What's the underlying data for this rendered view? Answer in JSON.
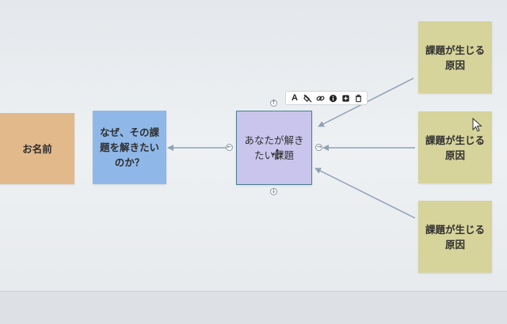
{
  "canvas": {
    "notes": {
      "name": {
        "label": "お名前",
        "color": "#e2b98b"
      },
      "why": {
        "label": "なぜ、その課\n題を解きたい\nのか？",
        "color": "#8fb8e8"
      },
      "center": {
        "label": "あなたが解き\nたい課題",
        "color": "#c9c5ec"
      },
      "causes": [
        {
          "label": "課題が生じる\n原因",
          "color": "#d6d39b"
        },
        {
          "label": "課題が生じる\n原因",
          "color": "#d6d39b"
        },
        {
          "label": "課題が生じる\n原因",
          "color": "#d6d39b"
        }
      ]
    },
    "toolbar": {
      "items": [
        {
          "icon": "text-format-icon",
          "glyph": "A"
        },
        {
          "icon": "fill-color-off-icon"
        },
        {
          "icon": "link-icon"
        },
        {
          "icon": "info-icon"
        },
        {
          "icon": "add-square-icon"
        },
        {
          "icon": "trash-icon"
        }
      ]
    },
    "link_color": "#8fa2b3"
  }
}
